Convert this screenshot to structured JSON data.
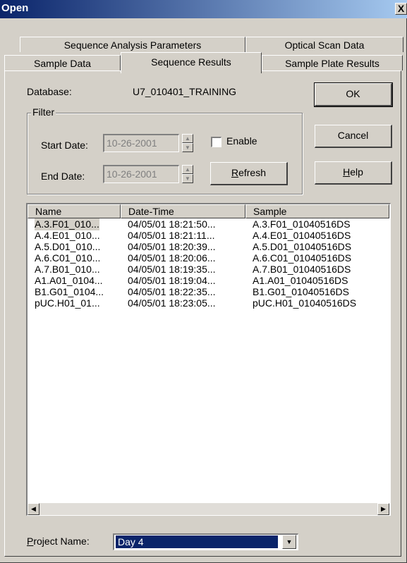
{
  "window": {
    "title": "Open",
    "close_label": "X"
  },
  "tabs": {
    "row1": [
      "Sequence Analysis Parameters",
      "Optical Scan Data"
    ],
    "row2": [
      "Sample Data",
      "Sequence Results",
      "Sample Plate Results"
    ],
    "active": "Sequence Results"
  },
  "database": {
    "label": "Database:",
    "value": "U7_010401_TRAINING"
  },
  "filter": {
    "caption": "Filter",
    "start_label": "Start Date:",
    "start_value": "10-26-2001",
    "end_label": "End Date:",
    "end_value": "10-26-2001",
    "enable_label": "Enable",
    "enable_checked": false,
    "refresh_label": "Refresh",
    "refresh_mnemonic": "R",
    "refresh_rest": "efresh"
  },
  "buttons": {
    "ok": "OK",
    "cancel": "Cancel",
    "help_mnemonic": "H",
    "help_rest": "elp"
  },
  "list": {
    "columns": [
      "Name",
      "Date-Time",
      "Sample"
    ],
    "rows": [
      [
        "A.3.F01_010...",
        "04/05/01 18:21:50...",
        "A.3.F01_01040516DS"
      ],
      [
        "A.4.E01_010...",
        "04/05/01 18:21:11...",
        "A.4.E01_01040516DS"
      ],
      [
        "A.5.D01_010...",
        "04/05/01 18:20:39...",
        "A.5.D01_01040516DS"
      ],
      [
        "A.6.C01_010...",
        "04/05/01 18:20:06...",
        "A.6.C01_01040516DS"
      ],
      [
        "A.7.B01_010...",
        "04/05/01 18:19:35...",
        "A.7.B01_01040516DS"
      ],
      [
        "A1.A01_0104...",
        "04/05/01 18:19:04...",
        "A1.A01_01040516DS"
      ],
      [
        "B1.G01_0104...",
        "04/05/01 18:22:35...",
        "B1.G01_01040516DS"
      ],
      [
        "pUC.H01_01...",
        "04/05/01 18:23:05...",
        "pUC.H01_01040516DS"
      ]
    ]
  },
  "project": {
    "label_mnemonic": "P",
    "label_rest": "roject Name:",
    "value": "Day 4"
  },
  "colors": {
    "title_start": "#0a246a",
    "title_end": "#a6caf0",
    "face": "#d4d0c8",
    "selection": "#0a246a"
  }
}
